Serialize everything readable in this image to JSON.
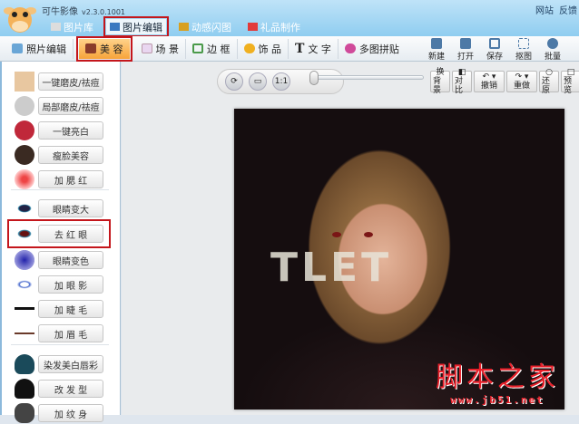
{
  "app": {
    "name": "可牛影像",
    "version": "v2.3.0.1001",
    "links": [
      "网站",
      "反馈"
    ]
  },
  "main_tabs": [
    {
      "label": "图片库"
    },
    {
      "label": "图片编辑",
      "active": true
    },
    {
      "label": "动感闪图"
    },
    {
      "label": "礼品制作"
    }
  ],
  "edit_tabs": [
    {
      "label": "照片编辑"
    },
    {
      "label": "美 容",
      "active": true
    },
    {
      "label": "场 景"
    },
    {
      "label": "边 框"
    },
    {
      "label": "饰 品"
    },
    {
      "label": "文 字"
    },
    {
      "label": "多图拼贴"
    }
  ],
  "file_buttons": [
    "新建",
    "打开",
    "保存",
    "抠图",
    "批量"
  ],
  "beauty_tools": [
    {
      "label": "一键磨皮/祛痘",
      "icon": "face-skin-icon"
    },
    {
      "label": "局部磨皮/祛痘",
      "icon": "face-sketch-icon"
    },
    {
      "label": "一键亮白",
      "icon": "opera-face-icon"
    },
    {
      "label": "瘦脸美容",
      "icon": "girl-face-icon"
    },
    {
      "label": "加 腮 红",
      "icon": "blush-icon"
    },
    {
      "label": "眼睛变大",
      "icon": "eye-icon"
    },
    {
      "label": "去 红 眼",
      "icon": "red-eye-icon",
      "highlighted": true
    },
    {
      "label": "眼睛变色",
      "icon": "iris-icon"
    },
    {
      "label": "加 眼 影",
      "icon": "eyeshadow-icon"
    },
    {
      "label": "加 睫 毛",
      "icon": "eyelash-icon"
    },
    {
      "label": "加 眉 毛",
      "icon": "eyebrow-icon"
    },
    {
      "label": "染发美白唇彩",
      "icon": "hair-dye-icon"
    },
    {
      "label": "改 发 型",
      "icon": "hairstyle-icon"
    },
    {
      "label": "加 纹 身",
      "icon": "tattoo-icon"
    }
  ],
  "view_tools": {
    "fit": "1:1"
  },
  "edit_buttons": [
    {
      "l1": "换",
      "l2": "背景"
    },
    {
      "l1": "◧",
      "l2": "对比"
    },
    {
      "l1": "↶ ▾",
      "l2": "撤销"
    },
    {
      "l1": "↷ ▾",
      "l2": "重做"
    },
    {
      "l1": "○",
      "l2": "还原"
    },
    {
      "l1": "□",
      "l2": "预览"
    }
  ],
  "photo": {
    "sign_text": "TLET",
    "watermark": "脚本之家",
    "watermark_url": "www.jb51.net"
  },
  "colors": {
    "highlight": "#c4161c",
    "titlebar": "#8fcdf0"
  }
}
